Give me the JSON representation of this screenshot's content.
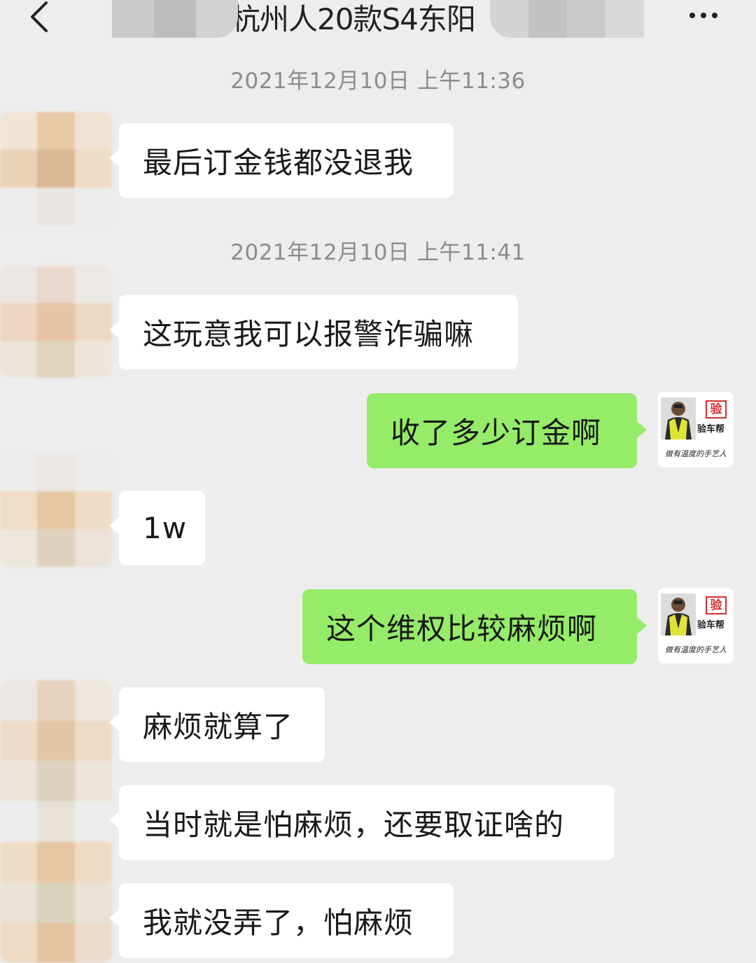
{
  "header": {
    "back_icon": "chevron-left-icon",
    "title": "杭州人20款S4东阳",
    "more_icon": "more-horizontal-icon"
  },
  "messages": [
    {
      "type": "timestamp",
      "text": "2021年12月10日 上午11:36"
    },
    {
      "type": "received",
      "text": "最后订金钱都没退我"
    },
    {
      "type": "timestamp",
      "text": "2021年12月10日 上午11:41"
    },
    {
      "type": "received",
      "text": "这玩意我可以报警诈骗嘛"
    },
    {
      "type": "sent",
      "text": "收了多少订金啊"
    },
    {
      "type": "received",
      "text": "1w"
    },
    {
      "type": "sent",
      "text": "这个维权比较麻烦啊"
    },
    {
      "type": "received",
      "text": "麻烦就算了"
    },
    {
      "type": "received",
      "text": "当时就是怕麻烦，还要取证啥的"
    },
    {
      "type": "received",
      "text": "我就没弄了，怕麻烦"
    }
  ],
  "my_avatar": {
    "seal_char": "验",
    "brand": "验车帮",
    "slogan": "做有温度的手艺人"
  },
  "colors": {
    "background": "#ededed",
    "sent_bubble": "#95ec69",
    "received_bubble": "#ffffff",
    "timestamp_text": "#8c8c8c"
  }
}
